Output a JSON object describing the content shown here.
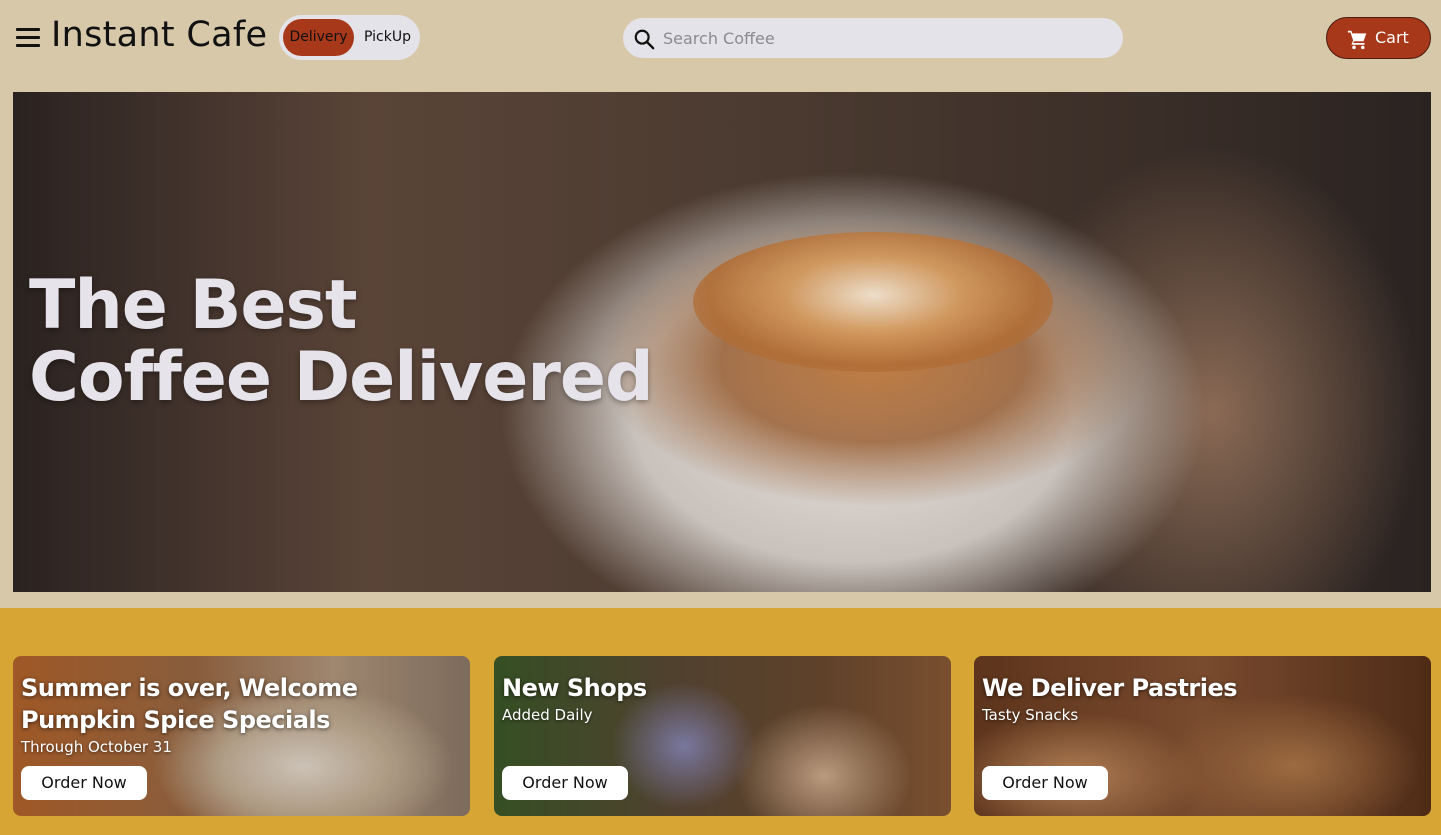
{
  "header": {
    "brand": "Instant Cafe",
    "mode_options": [
      "Delivery",
      "PickUp"
    ],
    "selected_mode": "Delivery",
    "search_placeholder": "Search Coffee",
    "search_value": "",
    "cart_label": "Cart"
  },
  "hero": {
    "title_line1": "The Best",
    "title_line2": "Coffee Delivered"
  },
  "promos": [
    {
      "title": "Summer is over, Welcome Pumpkin Spice Specials",
      "subtitle": "Through October 31",
      "button": "Order Now"
    },
    {
      "title": "New Shops",
      "subtitle": "Added Daily",
      "button": "Order Now"
    },
    {
      "title": "We Deliver Pastries",
      "subtitle": "Tasty Snacks",
      "button": "Order Now"
    }
  ],
  "colors": {
    "page_bg": "#d6c8a9",
    "accent": "#a8381a",
    "promo_band": "#d6a534",
    "pill_bg": "#e4e3e9"
  },
  "icons": [
    "menu-icon",
    "search-icon",
    "cart-icon"
  ]
}
